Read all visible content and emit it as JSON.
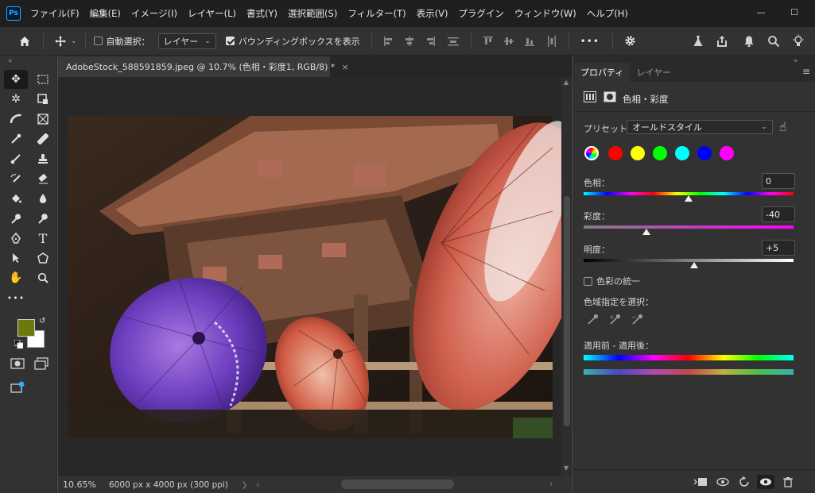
{
  "app": {
    "logo": "Ps",
    "menu": [
      "ファイル(F)",
      "編集(E)",
      "イメージ(I)",
      "レイヤー(L)",
      "書式(Y)",
      "選択範囲(S)",
      "フィルター(T)",
      "表示(V)",
      "プラグイン",
      "ウィンドウ(W)",
      "ヘルプ(H)"
    ],
    "window_controls": {
      "minimize": "—",
      "maximize": "☐"
    }
  },
  "options": {
    "auto_select_label": "自動選択：",
    "auto_select_checked": false,
    "target_value": "レイヤー",
    "bounding_box_label": "バウンディングボックスを表示",
    "bounding_box_checked": true,
    "more": "•••"
  },
  "document": {
    "tab_title": "AdobeStock_588591859.jpeg @ 10.7% (色相・彩度1, RGB/8) *",
    "close": "×",
    "zoom": "10.65%",
    "size_info": "6000 px x 4000 px (300 ppi)",
    "status_arrow": "〉",
    "status_left_arrow": "‹",
    "status_right_arrow": "›"
  },
  "panel": {
    "tabs": [
      "プロパティ",
      "レイヤー"
    ],
    "active_tab": "プロパティ",
    "adjustment_title": "色相・彩度",
    "preset_label": "プリセット：",
    "preset_value": "オールドスタイル",
    "presets_colors": [
      "#ff0000",
      "#ffff00",
      "#00ff00",
      "#00ffff",
      "#0000ff",
      "#ff00ff"
    ],
    "hue": {
      "label": "色相：",
      "value": "0",
      "min": -180,
      "max": 180,
      "current": 0
    },
    "saturation": {
      "label": "彩度：",
      "value": "-40",
      "min": -100,
      "max": 100,
      "current": -40
    },
    "lightness": {
      "label": "明度：",
      "value": "+5",
      "min": -100,
      "max": 100,
      "current": 5
    },
    "colorize_label": "色彩の統一",
    "colorize_checked": false,
    "range_label": "色域指定を選択：",
    "before_after_label": "適用前 - 適用後："
  },
  "colors": {
    "foreground": "#6b7a0b",
    "background": "#ffffff",
    "accent": "#31a8ff"
  }
}
